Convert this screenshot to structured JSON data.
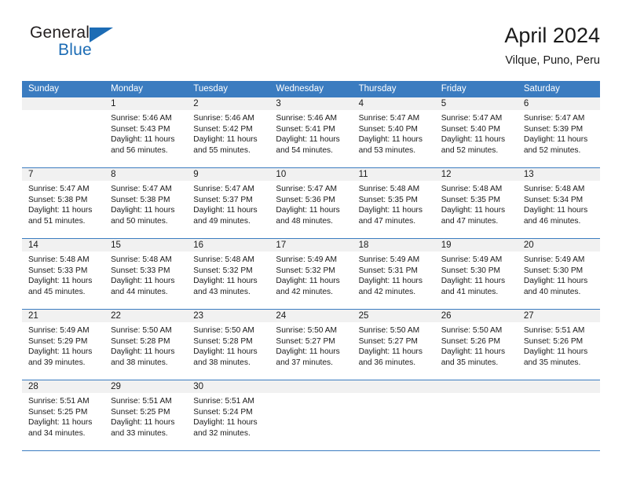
{
  "brand": {
    "name_top": "General",
    "name_bottom": "Blue",
    "triangle_icon": "blue-triangle-icon",
    "color_dark": "#231f20",
    "color_blue": "#1c6cb5"
  },
  "header": {
    "title": "April 2024",
    "subtitle": "Vilque, Puno, Peru"
  },
  "theme": {
    "header_blue": "#3b7cc0",
    "day_band_gray": "#f1f1f1",
    "text": "#1a1a1a"
  },
  "calendar": {
    "weekday_headers": [
      "Sunday",
      "Monday",
      "Tuesday",
      "Wednesday",
      "Thursday",
      "Friday",
      "Saturday"
    ],
    "weeks": [
      [
        {
          "day": "",
          "sunrise": "",
          "sunset": "",
          "daylight_line1": "",
          "daylight_line2": ""
        },
        {
          "day": "1",
          "sunrise": "Sunrise: 5:46 AM",
          "sunset": "Sunset: 5:43 PM",
          "daylight_line1": "Daylight: 11 hours",
          "daylight_line2": "and 56 minutes."
        },
        {
          "day": "2",
          "sunrise": "Sunrise: 5:46 AM",
          "sunset": "Sunset: 5:42 PM",
          "daylight_line1": "Daylight: 11 hours",
          "daylight_line2": "and 55 minutes."
        },
        {
          "day": "3",
          "sunrise": "Sunrise: 5:46 AM",
          "sunset": "Sunset: 5:41 PM",
          "daylight_line1": "Daylight: 11 hours",
          "daylight_line2": "and 54 minutes."
        },
        {
          "day": "4",
          "sunrise": "Sunrise: 5:47 AM",
          "sunset": "Sunset: 5:40 PM",
          "daylight_line1": "Daylight: 11 hours",
          "daylight_line2": "and 53 minutes."
        },
        {
          "day": "5",
          "sunrise": "Sunrise: 5:47 AM",
          "sunset": "Sunset: 5:40 PM",
          "daylight_line1": "Daylight: 11 hours",
          "daylight_line2": "and 52 minutes."
        },
        {
          "day": "6",
          "sunrise": "Sunrise: 5:47 AM",
          "sunset": "Sunset: 5:39 PM",
          "daylight_line1": "Daylight: 11 hours",
          "daylight_line2": "and 52 minutes."
        }
      ],
      [
        {
          "day": "7",
          "sunrise": "Sunrise: 5:47 AM",
          "sunset": "Sunset: 5:38 PM",
          "daylight_line1": "Daylight: 11 hours",
          "daylight_line2": "and 51 minutes."
        },
        {
          "day": "8",
          "sunrise": "Sunrise: 5:47 AM",
          "sunset": "Sunset: 5:38 PM",
          "daylight_line1": "Daylight: 11 hours",
          "daylight_line2": "and 50 minutes."
        },
        {
          "day": "9",
          "sunrise": "Sunrise: 5:47 AM",
          "sunset": "Sunset: 5:37 PM",
          "daylight_line1": "Daylight: 11 hours",
          "daylight_line2": "and 49 minutes."
        },
        {
          "day": "10",
          "sunrise": "Sunrise: 5:47 AM",
          "sunset": "Sunset: 5:36 PM",
          "daylight_line1": "Daylight: 11 hours",
          "daylight_line2": "and 48 minutes."
        },
        {
          "day": "11",
          "sunrise": "Sunrise: 5:48 AM",
          "sunset": "Sunset: 5:35 PM",
          "daylight_line1": "Daylight: 11 hours",
          "daylight_line2": "and 47 minutes."
        },
        {
          "day": "12",
          "sunrise": "Sunrise: 5:48 AM",
          "sunset": "Sunset: 5:35 PM",
          "daylight_line1": "Daylight: 11 hours",
          "daylight_line2": "and 47 minutes."
        },
        {
          "day": "13",
          "sunrise": "Sunrise: 5:48 AM",
          "sunset": "Sunset: 5:34 PM",
          "daylight_line1": "Daylight: 11 hours",
          "daylight_line2": "and 46 minutes."
        }
      ],
      [
        {
          "day": "14",
          "sunrise": "Sunrise: 5:48 AM",
          "sunset": "Sunset: 5:33 PM",
          "daylight_line1": "Daylight: 11 hours",
          "daylight_line2": "and 45 minutes."
        },
        {
          "day": "15",
          "sunrise": "Sunrise: 5:48 AM",
          "sunset": "Sunset: 5:33 PM",
          "daylight_line1": "Daylight: 11 hours",
          "daylight_line2": "and 44 minutes."
        },
        {
          "day": "16",
          "sunrise": "Sunrise: 5:48 AM",
          "sunset": "Sunset: 5:32 PM",
          "daylight_line1": "Daylight: 11 hours",
          "daylight_line2": "and 43 minutes."
        },
        {
          "day": "17",
          "sunrise": "Sunrise: 5:49 AM",
          "sunset": "Sunset: 5:32 PM",
          "daylight_line1": "Daylight: 11 hours",
          "daylight_line2": "and 42 minutes."
        },
        {
          "day": "18",
          "sunrise": "Sunrise: 5:49 AM",
          "sunset": "Sunset: 5:31 PM",
          "daylight_line1": "Daylight: 11 hours",
          "daylight_line2": "and 42 minutes."
        },
        {
          "day": "19",
          "sunrise": "Sunrise: 5:49 AM",
          "sunset": "Sunset: 5:30 PM",
          "daylight_line1": "Daylight: 11 hours",
          "daylight_line2": "and 41 minutes."
        },
        {
          "day": "20",
          "sunrise": "Sunrise: 5:49 AM",
          "sunset": "Sunset: 5:30 PM",
          "daylight_line1": "Daylight: 11 hours",
          "daylight_line2": "and 40 minutes."
        }
      ],
      [
        {
          "day": "21",
          "sunrise": "Sunrise: 5:49 AM",
          "sunset": "Sunset: 5:29 PM",
          "daylight_line1": "Daylight: 11 hours",
          "daylight_line2": "and 39 minutes."
        },
        {
          "day": "22",
          "sunrise": "Sunrise: 5:50 AM",
          "sunset": "Sunset: 5:28 PM",
          "daylight_line1": "Daylight: 11 hours",
          "daylight_line2": "and 38 minutes."
        },
        {
          "day": "23",
          "sunrise": "Sunrise: 5:50 AM",
          "sunset": "Sunset: 5:28 PM",
          "daylight_line1": "Daylight: 11 hours",
          "daylight_line2": "and 38 minutes."
        },
        {
          "day": "24",
          "sunrise": "Sunrise: 5:50 AM",
          "sunset": "Sunset: 5:27 PM",
          "daylight_line1": "Daylight: 11 hours",
          "daylight_line2": "and 37 minutes."
        },
        {
          "day": "25",
          "sunrise": "Sunrise: 5:50 AM",
          "sunset": "Sunset: 5:27 PM",
          "daylight_line1": "Daylight: 11 hours",
          "daylight_line2": "and 36 minutes."
        },
        {
          "day": "26",
          "sunrise": "Sunrise: 5:50 AM",
          "sunset": "Sunset: 5:26 PM",
          "daylight_line1": "Daylight: 11 hours",
          "daylight_line2": "and 35 minutes."
        },
        {
          "day": "27",
          "sunrise": "Sunrise: 5:51 AM",
          "sunset": "Sunset: 5:26 PM",
          "daylight_line1": "Daylight: 11 hours",
          "daylight_line2": "and 35 minutes."
        }
      ],
      [
        {
          "day": "28",
          "sunrise": "Sunrise: 5:51 AM",
          "sunset": "Sunset: 5:25 PM",
          "daylight_line1": "Daylight: 11 hours",
          "daylight_line2": "and 34 minutes."
        },
        {
          "day": "29",
          "sunrise": "Sunrise: 5:51 AM",
          "sunset": "Sunset: 5:25 PM",
          "daylight_line1": "Daylight: 11 hours",
          "daylight_line2": "and 33 minutes."
        },
        {
          "day": "30",
          "sunrise": "Sunrise: 5:51 AM",
          "sunset": "Sunset: 5:24 PM",
          "daylight_line1": "Daylight: 11 hours",
          "daylight_line2": "and 32 minutes."
        },
        {
          "day": "",
          "sunrise": "",
          "sunset": "",
          "daylight_line1": "",
          "daylight_line2": ""
        },
        {
          "day": "",
          "sunrise": "",
          "sunset": "",
          "daylight_line1": "",
          "daylight_line2": ""
        },
        {
          "day": "",
          "sunrise": "",
          "sunset": "",
          "daylight_line1": "",
          "daylight_line2": ""
        },
        {
          "day": "",
          "sunrise": "",
          "sunset": "",
          "daylight_line1": "",
          "daylight_line2": ""
        }
      ]
    ]
  }
}
